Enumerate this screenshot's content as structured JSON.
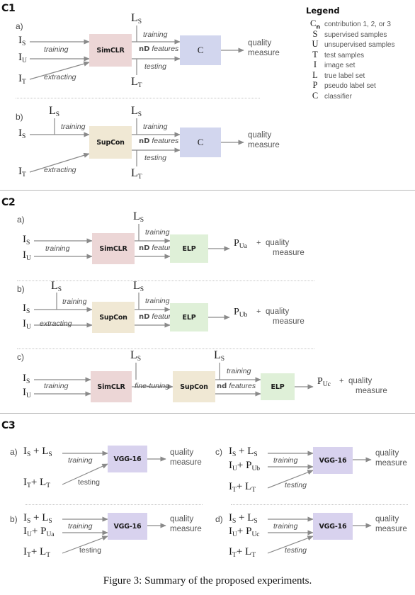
{
  "caption": "Figure 3: Summary of the proposed experiments.",
  "legend": {
    "title": "Legend",
    "rows": [
      {
        "sym": "C",
        "sub": "n",
        "desc": "contribution 1, 2, or 3"
      },
      {
        "sym": "S",
        "sub": "",
        "desc": "supervised samples"
      },
      {
        "sym": "U",
        "sub": "",
        "desc": "unsupervised samples"
      },
      {
        "sym": "T",
        "sub": "",
        "desc": "test samples"
      },
      {
        "sym": "I",
        "sub": "",
        "desc": "image set"
      },
      {
        "sym": "L",
        "sub": "",
        "desc": "true label set"
      },
      {
        "sym": "P",
        "sub": "",
        "desc": "pseudo label set"
      },
      {
        "sym": "C",
        "sub": "",
        "desc": "classifier"
      }
    ]
  },
  "colors": {
    "simclr": "#ecd6d6",
    "supcon": "#f0e8d4",
    "elp": "#dff0d8",
    "classifier": "#d2d6ee",
    "vgg": "#d8d2ee",
    "arrow": "#8a8a8a",
    "rule": "#b9b9b9",
    "dotted": "#c2c2c2"
  },
  "sections": [
    {
      "id": "C1",
      "label": "C1",
      "panels": [
        {
          "letter": "a)",
          "inputs": [
            "I_S",
            "I_U",
            "I_T"
          ],
          "labels": [
            "training",
            "extracting",
            "training",
            "testing",
            "nD features"
          ],
          "top_label": "L_S",
          "bottom_label": "L_T",
          "model": "SimCLR",
          "head": "C",
          "outcome": [
            "quality",
            "measure"
          ]
        },
        {
          "letter": "b)",
          "inputs": [
            "I_S",
            "I_T"
          ],
          "labels": [
            "training",
            "extracting",
            "training",
            "testing",
            "nD features"
          ],
          "top_label": "L_S",
          "bottom_label": "L_T",
          "model": "SupCon",
          "head": "C",
          "outcome": [
            "quality",
            "measure"
          ]
        }
      ]
    },
    {
      "id": "C2",
      "label": "C2",
      "panels": [
        {
          "letter": "a)",
          "inputs": [
            "I_S",
            "I_U"
          ],
          "labels": [
            "training",
            "training",
            "nD features"
          ],
          "top_label": "L_S",
          "model": "SimCLR",
          "head": "ELP",
          "outcome_sym": "P_Ua",
          "outcome": [
            "quality",
            "measure"
          ]
        },
        {
          "letter": "b)",
          "inputs": [
            "I_S",
            "I_U"
          ],
          "labels": [
            "training",
            "extracting",
            "training",
            "nD features"
          ],
          "top_label": "L_S",
          "model": "SupCon",
          "head": "ELP",
          "outcome_sym": "P_Ub",
          "outcome": [
            "quality",
            "measure"
          ]
        },
        {
          "letter": "c)",
          "inputs": [
            "I_S",
            "I_U"
          ],
          "labels": [
            "training",
            "fine-tuning",
            "training",
            "nd features"
          ],
          "top_label": "L_S",
          "model": "SimCLR",
          "model2": "SupCon",
          "head": "ELP",
          "outcome_sym": "P_Uc",
          "outcome": [
            "quality",
            "measure"
          ]
        }
      ]
    },
    {
      "id": "C3",
      "label": "C3",
      "panels": [
        {
          "letter": "a)",
          "rows": [
            "I_S + L_S",
            "I_T + L_T"
          ],
          "labels": [
            "training",
            "testing"
          ],
          "model": "VGG-16",
          "outcome": [
            "quality",
            "measure"
          ]
        },
        {
          "letter": "b)",
          "rows": [
            "I_S + L_S",
            "I_U + P_Ua",
            "I_T + L_T"
          ],
          "labels": [
            "training",
            "testing"
          ],
          "model": "VGG-16",
          "outcome": [
            "quality",
            "measure"
          ]
        },
        {
          "letter": "c)",
          "rows": [
            "I_S + L_S",
            "I_U + P_Ub",
            "I_T + L_T"
          ],
          "labels": [
            "training",
            "testing"
          ],
          "model": "VGG-16",
          "outcome": [
            "quality",
            "measure"
          ]
        },
        {
          "letter": "d)",
          "rows": [
            "I_S + L_S",
            "I_U + P_Uc",
            "I_T + L_T"
          ],
          "labels": [
            "training",
            "testing"
          ],
          "model": "VGG-16",
          "outcome": [
            "quality",
            "measure"
          ]
        }
      ]
    }
  ],
  "text": {
    "C1": "C1",
    "C2": "C2",
    "C3": "C3",
    "a": "a)",
    "b": "b)",
    "c": "c)",
    "d": "d)",
    "training": "training",
    "testing": "testing",
    "extracting": "extracting",
    "finetuning": "fine-tuning",
    "ndfeatures_up": "nD",
    "ndfeatures_low": "nd",
    "features": "features",
    "simclr": "SimCLR",
    "supcon": "SupCon",
    "elp": "ELP",
    "vgg": "VGG-16",
    "classifier": "C",
    "quality": "quality",
    "measure": "measure",
    "plus": "+"
  }
}
